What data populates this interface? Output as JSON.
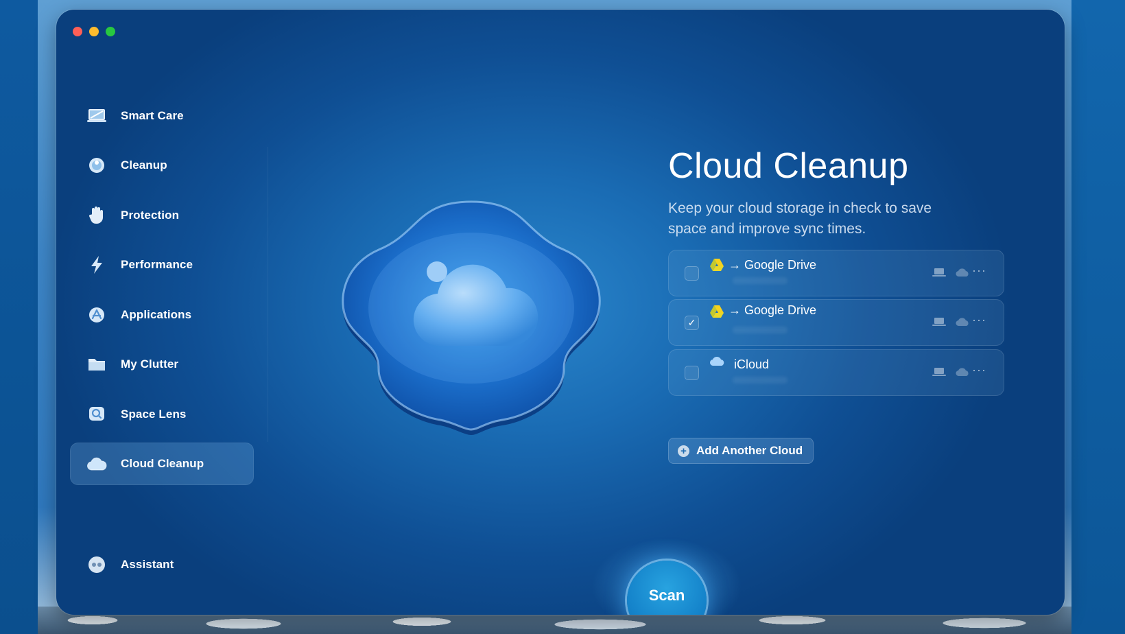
{
  "sidebar": {
    "items": [
      {
        "label": "Smart Care",
        "icon": "smart-care-icon"
      },
      {
        "label": "Cleanup",
        "icon": "cleanup-icon"
      },
      {
        "label": "Protection",
        "icon": "hand-icon"
      },
      {
        "label": "Performance",
        "icon": "lightning-icon"
      },
      {
        "label": "Applications",
        "icon": "applications-icon"
      },
      {
        "label": "My Clutter",
        "icon": "folder-icon"
      },
      {
        "label": "Space Lens",
        "icon": "space-lens-icon"
      },
      {
        "label": "Cloud Cleanup",
        "icon": "cloud-icon",
        "active": true
      }
    ],
    "assistant": {
      "label": "Assistant",
      "icon": "assistant-icon"
    }
  },
  "main": {
    "title": "Cloud Cleanup",
    "subtitle": "Keep your cloud storage in check to save space and improve sync times.",
    "clouds": [
      {
        "name": "→ Google Drive",
        "checked": false,
        "icon": "google-drive-icon"
      },
      {
        "name": "→ Google Drive",
        "checked": true,
        "check_glyph": "✓",
        "icon": "google-drive-icon"
      },
      {
        "name": "iCloud",
        "checked": false,
        "icon": "icloud-icon"
      }
    ],
    "add_button_label": "Add Another Cloud",
    "more_glyph": "···",
    "add_glyph": "+"
  },
  "scan_label": "Scan",
  "colors": {
    "accent": "#1584cb",
    "window_bg": "#1a6cb4",
    "traffic_red": "#fe5f57",
    "traffic_yellow": "#febc2e",
    "traffic_green": "#28c840"
  }
}
